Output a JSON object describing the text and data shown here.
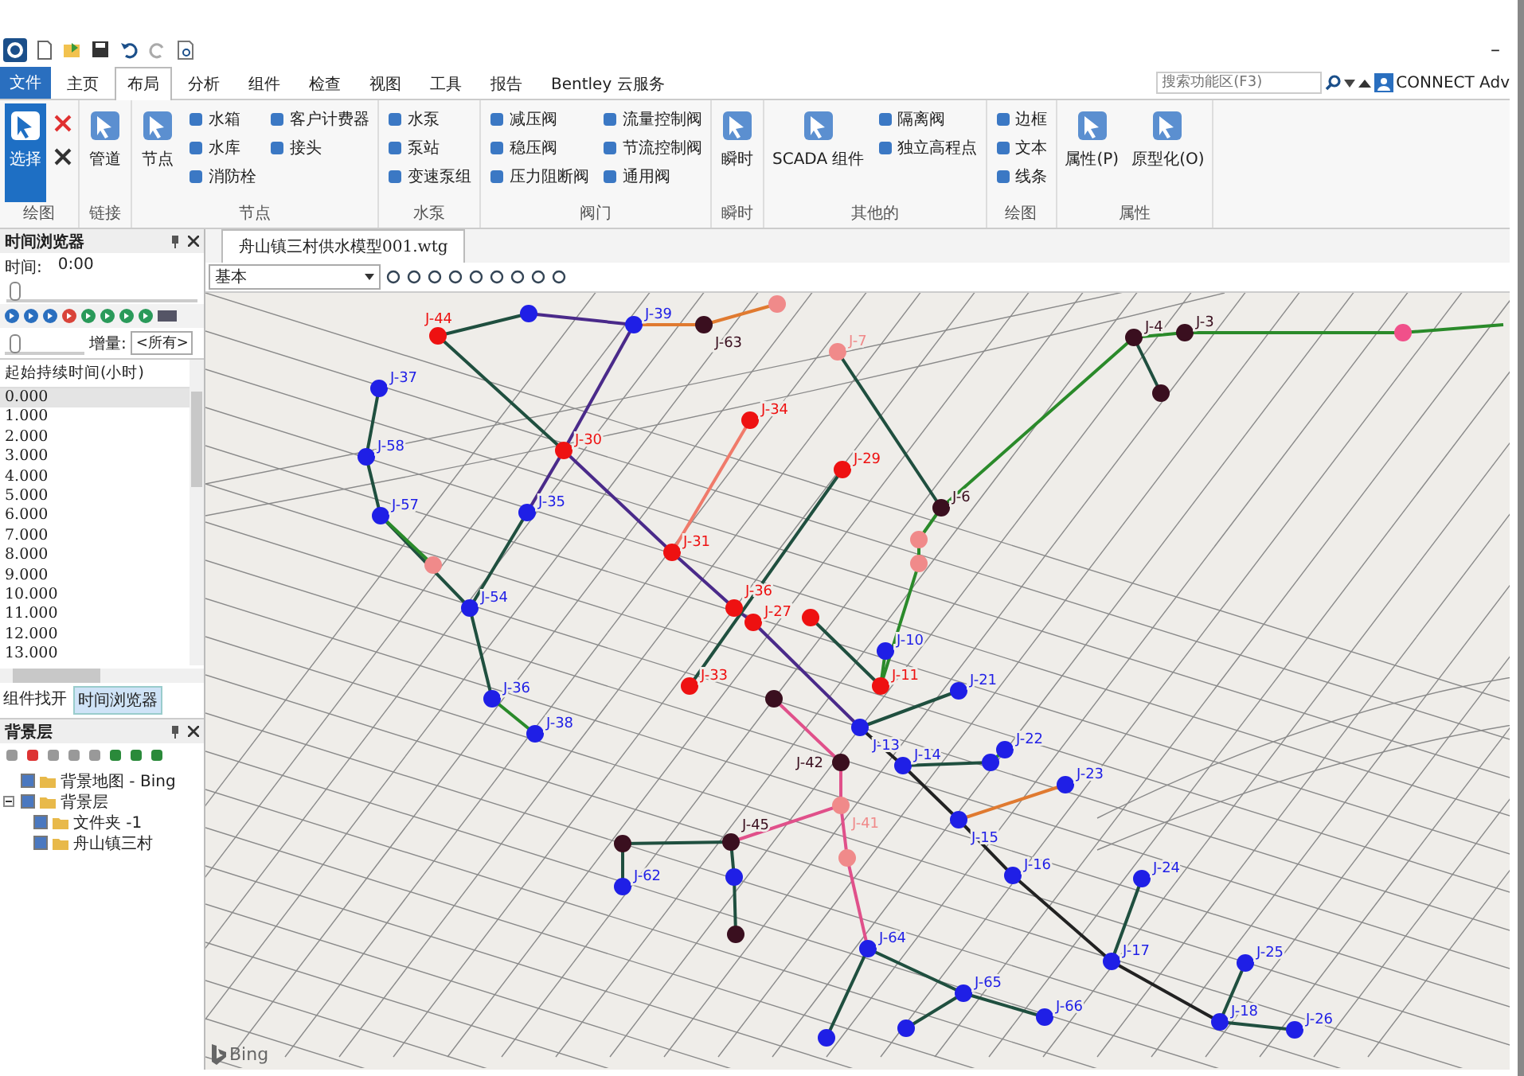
{
  "title_bar": {
    "minimize": "–"
  },
  "tabs": [
    {
      "label": "文件",
      "kind": "file",
      "selected": false
    },
    {
      "label": "主页",
      "kind": "tab",
      "selected": false
    },
    {
      "label": "布局",
      "kind": "tab",
      "selected": true
    },
    {
      "label": "分析",
      "kind": "tab",
      "selected": false
    },
    {
      "label": "组件",
      "kind": "tab",
      "selected": false
    },
    {
      "label": "检查",
      "kind": "tab",
      "selected": false
    },
    {
      "label": "视图",
      "kind": "tab",
      "selected": false
    },
    {
      "label": "工具",
      "kind": "tab",
      "selected": false
    },
    {
      "label": "报告",
      "kind": "tab",
      "selected": false
    },
    {
      "label": "Bentley 云服务",
      "kind": "tab",
      "selected": false
    }
  ],
  "search": {
    "placeholder": "搜索功能区(F3)"
  },
  "account": {
    "label": "CONNECT Adv"
  },
  "ribbon_groups": [
    {
      "label": "绘图",
      "items": [
        {
          "label": "选择",
          "kind": "large",
          "selected": true
        },
        {
          "kind": "stack"
        }
      ]
    },
    {
      "label": "链接",
      "items": [
        {
          "label": "管道",
          "kind": "large",
          "selected": false
        }
      ]
    },
    {
      "label": "节点",
      "items": [
        {
          "label": "节点",
          "kind": "large",
          "selected": false
        },
        {
          "kind": "column",
          "labels": [
            "水箱",
            "水库",
            "消防栓"
          ]
        },
        {
          "kind": "column",
          "labels": [
            "客户计费器",
            "接头"
          ]
        }
      ]
    },
    {
      "label": "水泵",
      "items": [
        {
          "kind": "column",
          "labels": [
            "水泵",
            "泵站",
            "变速泵组"
          ]
        }
      ]
    },
    {
      "label": "阀门",
      "items": [
        {
          "kind": "column",
          "labels": [
            "减压阀",
            "稳压阀",
            "压力阻断阀"
          ]
        },
        {
          "kind": "column",
          "labels": [
            "流量控制阀",
            "节流控制阀",
            "通用阀"
          ]
        }
      ]
    },
    {
      "label": "瞬时",
      "items": [
        {
          "label": "瞬时",
          "kind": "large",
          "selected": false
        }
      ]
    },
    {
      "label": "其他的",
      "items": [
        {
          "label": "SCADA 组件",
          "kind": "large",
          "selected": false
        },
        {
          "kind": "column",
          "labels": [
            "隔离阀",
            "独立高程点"
          ]
        }
      ]
    },
    {
      "label": "绘图",
      "items": [
        {
          "kind": "column",
          "labels": [
            "边框",
            "文本",
            "线条"
          ]
        }
      ]
    },
    {
      "label": "属性",
      "items": [
        {
          "label": "属性(P)",
          "kind": "large",
          "selected": false
        },
        {
          "label": "原型化(O)",
          "kind": "large",
          "selected": false
        }
      ]
    }
  ],
  "time_browser": {
    "title": "时间浏览器",
    "time_label": "时间:",
    "time_value": "0:00",
    "time_slider": {
      "level": 0.02
    },
    "speed_slider": {
      "level": 0.05
    },
    "increment_label": "增量:",
    "increment_value": "<所有>",
    "column": "起始持续时间(小时)",
    "rows": [
      {
        "value": "0.000",
        "selected": true
      },
      {
        "value": "1.000",
        "selected": false
      },
      {
        "value": "2.000",
        "selected": false
      },
      {
        "value": "3.000",
        "selected": false
      },
      {
        "value": "4.000",
        "selected": false
      },
      {
        "value": "5.000",
        "selected": false
      },
      {
        "value": "6.000",
        "selected": false
      },
      {
        "value": "7.000",
        "selected": false
      },
      {
        "value": "8.000",
        "selected": false
      },
      {
        "value": "9.000",
        "selected": false
      },
      {
        "value": "10.000",
        "selected": false
      },
      {
        "value": "11.000",
        "selected": false
      },
      {
        "value": "12.000",
        "selected": false
      },
      {
        "value": "13.000",
        "selected": false
      }
    ]
  },
  "panel_tabs": [
    {
      "label": "组件找开",
      "selected": false
    },
    {
      "label": "时间浏览器",
      "selected": true
    }
  ],
  "background_layers": {
    "title": "背景层",
    "tree": [
      {
        "label": "背景地图 - Bing",
        "checked": true
      },
      {
        "label": "背景层",
        "checked": true,
        "expanded": true,
        "children": [
          {
            "label": "文件夹 -1",
            "checked": true
          },
          {
            "label": "舟山镇三村",
            "checked": true
          }
        ]
      }
    ]
  },
  "document": {
    "tab": "舟山镇三村供水模型001.wtg",
    "view": "基本",
    "map_credit": "Bing",
    "nodes": [
      {
        "label": "J-37",
        "color": "#1f1fe6"
      },
      {
        "label": "J-58",
        "color": "#1f1fe6"
      },
      {
        "label": "J-57",
        "color": "#1f1fe6"
      },
      {
        "color": "#f08a8a"
      },
      {
        "label": "J-54",
        "color": "#1f1fe6"
      },
      {
        "label": "J-36",
        "color": "#1f1fe6"
      },
      {
        "label": "J-38",
        "color": "#1f1fe6"
      },
      {
        "label": "J-35",
        "color": "#1f1fe6"
      },
      {
        "label": "J-30",
        "color": "#ee1111"
      },
      {
        "label": "J-44",
        "color": "#ee1111"
      },
      {
        "color": "#1f1fe6"
      },
      {
        "label": "J-39",
        "color": "#1f1fe6"
      },
      {
        "label": "J-63",
        "color": "#3a0f1f"
      },
      {
        "color": "#f08a8a"
      },
      {
        "label": "J-34",
        "color": "#ee1111"
      },
      {
        "label": "J-7",
        "color": "#f08a8a"
      },
      {
        "label": "J-29",
        "color": "#ee1111"
      },
      {
        "label": "J-31",
        "color": "#ee1111"
      },
      {
        "label": "J-36",
        "color": "#ee1111"
      },
      {
        "label": "J-27",
        "color": "#ee1111"
      },
      {
        "color": "#ee1111"
      },
      {
        "label": "J-33",
        "color": "#ee1111"
      },
      {
        "color": "#3a0f1f"
      },
      {
        "label": "J-6",
        "color": "#3a0f1f"
      },
      {
        "color": "#f08a8a"
      },
      {
        "color": "#f08a8a"
      },
      {
        "label": "J-10",
        "color": "#1f1fe6"
      },
      {
        "label": "J-11",
        "color": "#ee1111"
      },
      {
        "label": "J-13",
        "color": "#1f1fe6"
      },
      {
        "label": "J-21",
        "color": "#1f1fe6"
      },
      {
        "label": "J-22",
        "color": "#1f1fe6"
      },
      {
        "label": "J-14",
        "color": "#1f1fe6"
      },
      {
        "label": "J-15",
        "color": "#1f1fe6"
      },
      {
        "color": "#1f1fe6"
      },
      {
        "label": "J-23",
        "color": "#1f1fe6"
      },
      {
        "label": "J-16",
        "color": "#1f1fe6"
      },
      {
        "label": "J-24",
        "color": "#1f1fe6"
      },
      {
        "label": "J-17",
        "color": "#1f1fe6"
      },
      {
        "label": "J-25",
        "color": "#1f1fe6"
      },
      {
        "label": "J-18",
        "color": "#1f1fe6"
      },
      {
        "label": "J-26",
        "color": "#1f1fe6"
      },
      {
        "label": "J-4",
        "color": "#3a0f1f"
      },
      {
        "label": "J-3",
        "color": "#3a0f1f"
      },
      {
        "color": "#3a0f1f"
      },
      {
        "color": "#f0508a"
      },
      {
        "color": "#3a0f1f"
      },
      {
        "label": "J-45",
        "color": "#3a0f1f"
      },
      {
        "label": "J-62",
        "color": "#1f1fe6"
      },
      {
        "color": "#1f1fe6"
      },
      {
        "color": "#3a0f1f"
      },
      {
        "label": "J-41",
        "color": "#f08a8a"
      },
      {
        "color": "#f08a8a"
      },
      {
        "label": "J-42",
        "color": "#3a0f1f"
      },
      {
        "label": "J-64",
        "color": "#1f1fe6"
      },
      {
        "label": "J-65",
        "color": "#1f1fe6"
      },
      {
        "label": "J-66",
        "color": "#1f1fe6"
      },
      {
        "color": "#1f1fe6"
      },
      {
        "color": "#1f1fe6"
      }
    ]
  }
}
